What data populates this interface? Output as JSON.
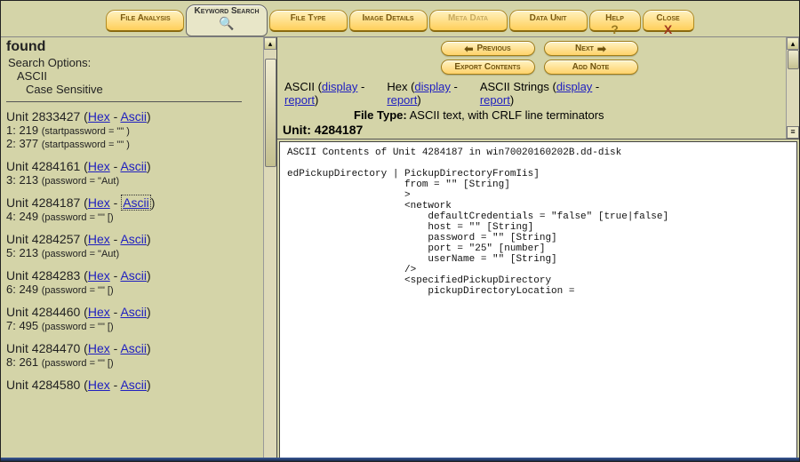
{
  "tabs": {
    "file_analysis": "File Analysis",
    "keyword_search": "Keyword Search",
    "file_type": "File Type",
    "image_details": "Image Details",
    "meta_data": "Meta Data",
    "data_unit": "Data Unit",
    "help": "Help",
    "close": "Close"
  },
  "left": {
    "found": "found",
    "search_options": "Search Options:",
    "ascii": "ASCII",
    "case_sensitive": "Case Sensitive",
    "units": [
      {
        "unit": "Unit 2833427",
        "hex": "Hex",
        "ascii": "Ascii",
        "current": false,
        "rows": [
          "1: 219 (startpassword = \"\" )",
          "2: 377 (startpassword = \"\" )"
        ]
      },
      {
        "unit": "Unit 4284161",
        "hex": "Hex",
        "ascii": "Ascii",
        "current": false,
        "rows": [
          "3: 213 (password = \"Aut)"
        ]
      },
      {
        "unit": "Unit 4284187",
        "hex": "Hex",
        "ascii": "Ascii",
        "current": true,
        "rows": [
          "4: 249 (password = \"\" [)"
        ]
      },
      {
        "unit": "Unit 4284257",
        "hex": "Hex",
        "ascii": "Ascii",
        "current": false,
        "rows": [
          "5: 213 (password = \"Aut)"
        ]
      },
      {
        "unit": "Unit 4284283",
        "hex": "Hex",
        "ascii": "Ascii",
        "current": false,
        "rows": [
          "6: 249 (password = \"\" [)"
        ]
      },
      {
        "unit": "Unit 4284460",
        "hex": "Hex",
        "ascii": "Ascii",
        "current": false,
        "rows": [
          "7: 495 (password = \"\" [)"
        ]
      },
      {
        "unit": "Unit 4284470",
        "hex": "Hex",
        "ascii": "Ascii",
        "current": false,
        "rows": [
          "8: 261 (password = \"\" [)"
        ]
      },
      {
        "unit": "Unit 4284580",
        "hex": "Hex",
        "ascii": "Ascii",
        "current": false,
        "rows": []
      }
    ]
  },
  "right": {
    "buttons": {
      "previous": "Previous",
      "next": "Next",
      "export": "Export Contents",
      "add_note": "Add Note"
    },
    "cols": {
      "ascii": "ASCII",
      "hex": "Hex",
      "ascii_strings": "ASCII Strings",
      "display": "display",
      "report": "report"
    },
    "file_type_label": "File Type:",
    "file_type_value": "ASCII text, with CRLF line terminators",
    "unit_label": "Unit:",
    "unit_value": "4284187",
    "content_header": "ASCII Contents of Unit 4284187 in win70020160202B.dd-disk",
    "content_body": "edPickupDirectory | PickupDirectoryFromIis]\n                    from = \"\" [String]\n                    >\n                    <network\n                        defaultCredentials = \"false\" [true|false]\n                        host = \"\" [String]\n                        password = \"\" [String]\n                        port = \"25\" [number]\n                        userName = \"\" [String]\n                    />\n                    <specifiedPickupDirectory\n                        pickupDirectoryLocation ="
  }
}
